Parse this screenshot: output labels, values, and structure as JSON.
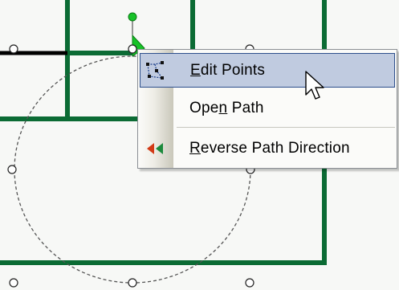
{
  "context_menu": {
    "items": [
      {
        "label": "Edit Points",
        "mnemonic": "E",
        "icon": "edit-points-icon",
        "highlighted": true
      },
      {
        "label": "Open Path",
        "mnemonic": "n",
        "icon": null,
        "highlighted": false
      },
      {
        "label": "Reverse Path Direction",
        "mnemonic": "R",
        "icon": "reverse-path-direction-icon",
        "highlighted": false
      }
    ]
  },
  "colors": {
    "canvas_bg": "#f7f8f6",
    "path_green": "#0b6b34",
    "path_black": "#000000",
    "handle_green": "#17c228",
    "selection_dash": "#555555",
    "menu_highlight": "#c0cbe0",
    "menu_highlight_border": "#2d4f8c"
  }
}
